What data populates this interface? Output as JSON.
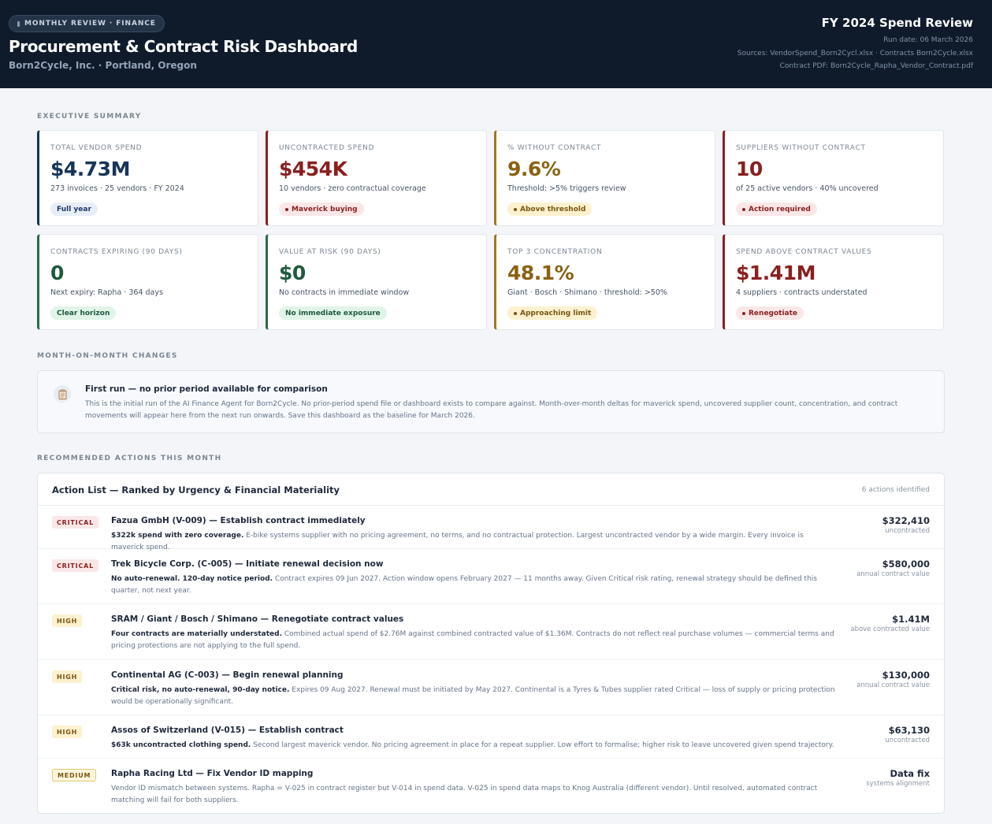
{
  "header": {
    "pill": "MONTHLY REVIEW · FINANCE",
    "title": "Procurement & Contract Risk Dashboard",
    "subtitle": "Born2Cycle, Inc. · Portland, Oregon",
    "right_title": "FY 2024 Spend Review",
    "run_date": "Run date: 06 March 2026",
    "sources": "Sources: VendorSpend_Born2Cycl.xlsx · Contracts Born2Cycle.xlsx",
    "contract_pdf": "Contract PDF: Born2Cycle_Rapha_Vendor_Contract.pdf"
  },
  "sections": {
    "executive": "EXECUTIVE SUMMARY",
    "mom": "MONTH-ON-MONTH CHANGES",
    "actions": "RECOMMENDED ACTIONS THIS MONTH"
  },
  "kpis": [
    {
      "label": "TOTAL VENDOR SPEND",
      "value": "$4.73M",
      "desc": "273 invoices · 25 vendors · FY 2024",
      "badge": "Full year",
      "tone": "navy",
      "badge_tone": "blue",
      "dot": false
    },
    {
      "label": "UNCONTRACTED SPEND",
      "value": "$454K",
      "desc": "10 vendors · zero contractual coverage",
      "badge": "Maverick buying",
      "tone": "red",
      "badge_tone": "red",
      "dot": true
    },
    {
      "label": "% WITHOUT CONTRACT",
      "value": "9.6%",
      "desc": "Threshold: >5% triggers review",
      "badge": "Above threshold",
      "tone": "amber",
      "badge_tone": "amber",
      "dot": true
    },
    {
      "label": "SUPPLIERS WITHOUT CONTRACT",
      "value": "10",
      "desc": "of 25 active vendors · 40% uncovered",
      "badge": "Action required",
      "tone": "red",
      "badge_tone": "red",
      "dot": true
    },
    {
      "label": "CONTRACTS EXPIRING (90 DAYS)",
      "value": "0",
      "desc": "Next expiry: Rapha · 364 days",
      "badge": "Clear horizon",
      "tone": "green",
      "badge_tone": "green",
      "dot": false
    },
    {
      "label": "VALUE AT RISK (90 DAYS)",
      "value": "$0",
      "desc": "No contracts in immediate window",
      "badge": "No immediate exposure",
      "tone": "green",
      "badge_tone": "green",
      "dot": false
    },
    {
      "label": "TOP 3 CONCENTRATION",
      "value": "48.1%",
      "desc": "Giant · Bosch · Shimano · threshold: >50%",
      "badge": "Approaching limit",
      "tone": "amber",
      "badge_tone": "amber",
      "dot": true
    },
    {
      "label": "SPEND ABOVE CONTRACT VALUES",
      "value": "$1.41M",
      "desc": "4 suppliers · contracts understated",
      "badge": "Renegotiate",
      "tone": "red",
      "badge_tone": "red",
      "dot": true
    }
  ],
  "notice": {
    "icon": "clipboard-icon",
    "title": "First run — no prior period available for comparison",
    "text": "This is the initial run of the AI Finance Agent for Born2Cycle. No prior-period spend file or dashboard exists to compare against. Month-over-month deltas for maverick spend, uncovered supplier count, concentration, and contract movements will appear here from the next run onwards. Save this dashboard as the baseline for March 2026."
  },
  "actions": {
    "title": "Action List — Ranked by Urgency & Financial Materiality",
    "count": "6 actions identified",
    "items": [
      {
        "severity": "CRITICAL",
        "sev": "critical",
        "title": "Fazua GmbH (V-009) — Establish contract immediately",
        "lead": "$322k spend with zero coverage.",
        "text": " E-bike systems supplier with no pricing agreement, no terms, and no contractual protection. Largest uncontracted vendor by a wide margin. Every invoice is maverick spend.",
        "amount": "$322,410",
        "amount_sub": "uncontracted"
      },
      {
        "severity": "CRITICAL",
        "sev": "critical",
        "title": "Trek Bicycle Corp. (C-005) — Initiate renewal decision now",
        "lead": "No auto-renewal. 120-day notice period.",
        "text": " Contract expires 09 Jun 2027. Action window opens February 2027 — 11 months away. Given Critical risk rating, renewal strategy should be defined this quarter, not next year.",
        "amount": "$580,000",
        "amount_sub": "annual contract value"
      },
      {
        "severity": "HIGH",
        "sev": "high",
        "title": "SRAM / Giant / Bosch / Shimano — Renegotiate contract values",
        "lead": "Four contracts are materially understated.",
        "text": " Combined actual spend of $2.76M against combined contracted value of $1.36M. Contracts do not reflect real purchase volumes — commercial terms and pricing protections are not applying to the full spend.",
        "amount": "$1.41M",
        "amount_sub": "above contracted value"
      },
      {
        "severity": "HIGH",
        "sev": "high",
        "title": "Continental AG (C-003) — Begin renewal planning",
        "lead": "Critical risk, no auto-renewal, 90-day notice.",
        "text": " Expires 09 Aug 2027. Renewal must be initiated by May 2027. Continental is a Tyres & Tubes supplier rated Critical — loss of supply or pricing protection would be operationally significant.",
        "amount": "$130,000",
        "amount_sub": "annual contract value"
      },
      {
        "severity": "HIGH",
        "sev": "high",
        "title": "Assos of Switzerland (V-015) — Establish contract",
        "lead": "$63k uncontracted clothing spend.",
        "text": " Second largest maverick vendor. No pricing agreement in place for a repeat supplier. Low effort to formalise; higher risk to leave uncovered given spend trajectory.",
        "amount": "$63,130",
        "amount_sub": "uncontracted"
      },
      {
        "severity": "MEDIUM",
        "sev": "medium",
        "title": "Rapha Racing Ltd — Fix Vendor ID mapping",
        "lead": "",
        "text": "Vendor ID mismatch between systems. Rapha = V-025 in contract register but V-014 in spend data. V-025 in spend data maps to Knog Australia (different vendor). Until resolved, automated contract matching will fail for both suppliers.",
        "amount": "Data fix",
        "amount_sub": "systems alignment"
      }
    ]
  }
}
